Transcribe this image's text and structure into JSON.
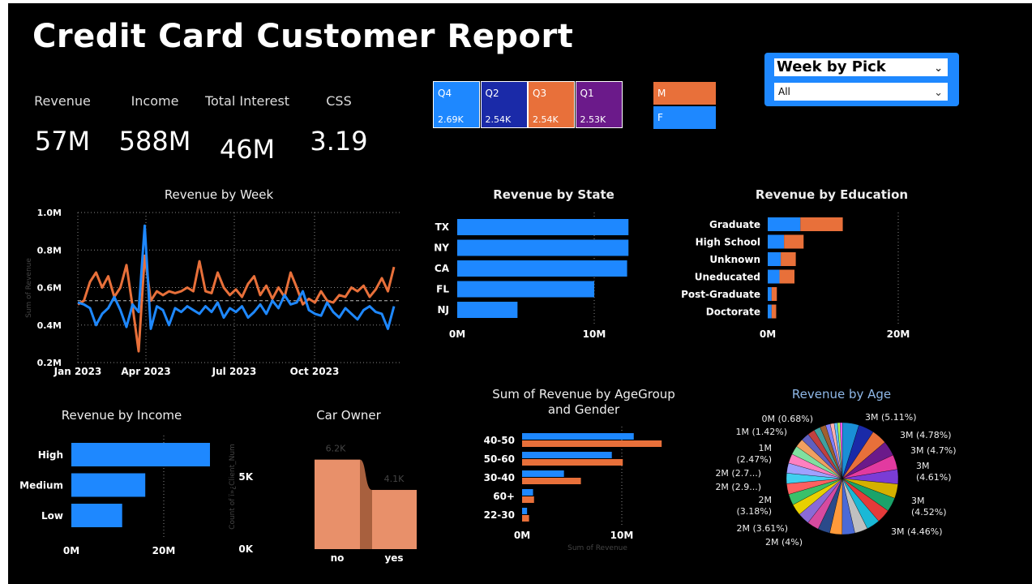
{
  "report": {
    "title": "Credit Card Customer Report"
  },
  "kpis": [
    {
      "label": "Revenue",
      "value": "57M"
    },
    {
      "label": "Income",
      "value": "588M"
    },
    {
      "label": "Total Interest",
      "value": "46M"
    },
    {
      "label": "CSS",
      "value": "3.19"
    }
  ],
  "quarters": [
    {
      "name": "Q4",
      "value": "2.69K",
      "color": "#1e88ff"
    },
    {
      "name": "Q2",
      "value": "2.54K",
      "color": "#1a2aa8"
    },
    {
      "name": "Q3",
      "value": "2.54K",
      "color": "#e8703a"
    },
    {
      "name": "Q1",
      "value": "2.53K",
      "color": "#6b1a8a"
    }
  ],
  "gender_tiles": [
    {
      "name": "M",
      "color": "#e8703a"
    },
    {
      "name": "F",
      "color": "#1e88ff"
    }
  ],
  "slicer": {
    "title": "Week by Pick",
    "selected": "All"
  },
  "colors": {
    "blue": "#1e88ff",
    "orange": "#e8703a",
    "salmon": "#e8906a"
  },
  "chart_data": [
    {
      "id": "week",
      "type": "line",
      "title": "Revenue by Week",
      "ylabel": "Sum of Revenue",
      "xlabel": "",
      "x_ticks": [
        "Jan 2023",
        "Apr 2023",
        "Jul 2023",
        "Oct 2023"
      ],
      "y_ticks": [
        "0.2M",
        "0.4M",
        "0.6M",
        "0.8M",
        "1.0M"
      ],
      "ylim": [
        0.2,
        1.0
      ],
      "series": [
        {
          "color": "#1e88ff",
          "values": [
            0.52,
            0.51,
            0.49,
            0.4,
            0.46,
            0.49,
            0.55,
            0.48,
            0.39,
            0.51,
            0.47,
            0.93,
            0.38,
            0.5,
            0.48,
            0.4,
            0.49,
            0.47,
            0.5,
            0.48,
            0.46,
            0.5,
            0.47,
            0.52,
            0.44,
            0.49,
            0.47,
            0.5,
            0.44,
            0.47,
            0.51,
            0.46,
            0.53,
            0.49,
            0.56,
            0.51,
            0.52,
            0.58,
            0.48,
            0.46,
            0.45,
            0.52,
            0.47,
            0.44,
            0.49,
            0.46,
            0.43,
            0.48,
            0.5,
            0.47,
            0.46,
            0.38,
            0.5
          ]
        },
        {
          "color": "#e8703a",
          "values": [
            0.51,
            0.53,
            0.63,
            0.68,
            0.6,
            0.66,
            0.55,
            0.6,
            0.72,
            0.5,
            0.26,
            0.77,
            0.53,
            0.58,
            0.56,
            0.58,
            0.57,
            0.58,
            0.6,
            0.58,
            0.74,
            0.58,
            0.57,
            0.68,
            0.6,
            0.56,
            0.59,
            0.55,
            0.62,
            0.66,
            0.56,
            0.61,
            0.54,
            0.6,
            0.55,
            0.68,
            0.6,
            0.51,
            0.54,
            0.52,
            0.58,
            0.53,
            0.52,
            0.56,
            0.55,
            0.6,
            0.58,
            0.61,
            0.55,
            0.59,
            0.65,
            0.58,
            0.71
          ]
        }
      ]
    },
    {
      "id": "state",
      "type": "bar",
      "title": "Revenue by State",
      "categories": [
        "TX",
        "NY",
        "CA",
        "FL",
        "NJ"
      ],
      "values": [
        12.5,
        12.5,
        12.4,
        10.0,
        4.4
      ],
      "x_ticks": [
        "0M",
        "10M"
      ],
      "xlim": [
        0,
        10
      ]
    },
    {
      "id": "education",
      "type": "bar",
      "title": "Revenue by Education",
      "categories": [
        "Graduate",
        "High School",
        "Unknown",
        "Uneducated",
        "Post-Graduate",
        "Doctorate"
      ],
      "series": [
        {
          "name": "F",
          "values": [
            5.0,
            2.5,
            2.0,
            1.8,
            0.6,
            0.6
          ]
        },
        {
          "name": "M",
          "values": [
            6.5,
            3.0,
            2.3,
            2.3,
            0.8,
            0.7
          ]
        }
      ],
      "x_ticks": [
        "0M",
        "20M"
      ],
      "xlim": [
        0,
        20
      ]
    },
    {
      "id": "income",
      "type": "bar",
      "title": "Revenue by Income",
      "categories": [
        "High",
        "Medium",
        "Low"
      ],
      "values": [
        30,
        16,
        11
      ],
      "x_ticks": [
        "0M",
        "20M"
      ],
      "xlim": [
        0,
        20
      ]
    },
    {
      "id": "car",
      "type": "area",
      "title": "Car Owner",
      "ylabel": "Count of ï»¿Client_Num",
      "categories": [
        "no",
        "yes"
      ],
      "values": [
        6.2,
        4.1
      ],
      "value_labels": [
        "6.2K",
        "4.1K"
      ],
      "y_ticks": [
        "0K",
        "5K"
      ]
    },
    {
      "id": "agegroup",
      "type": "bar",
      "title": "Sum of Revenue by AgeGroup and Gender",
      "xlabel": "Sum of Revenue",
      "categories": [
        "40-50",
        "50-60",
        "30-40",
        "60+",
        "22-30"
      ],
      "series": [
        {
          "name": "F",
          "values": [
            11.2,
            9.0,
            4.2,
            1.1,
            0.5
          ]
        },
        {
          "name": "M",
          "values": [
            14.0,
            10.1,
            5.9,
            1.2,
            0.7
          ]
        }
      ],
      "x_ticks": [
        "0M",
        "10M"
      ],
      "xlim": [
        0,
        10
      ]
    },
    {
      "id": "age",
      "type": "pie",
      "title": "Revenue by Age",
      "labels": [
        "3M (5.11%)",
        "3M (4.78%)",
        "3M (4.7%)",
        "3M\n(4.61%)",
        "3M\n(4.52%)",
        "3M (4.46%)",
        "2M (4%)",
        "2M (3.61%)",
        "2M\n(3.18%)",
        "2M (2.9...)",
        "2M (2.7...)",
        "1M\n(2.47%)",
        "1M (1.42%)",
        "0M (0.68%)"
      ],
      "values": [
        5.11,
        4.78,
        4.7,
        4.61,
        4.52,
        4.46,
        4.4,
        4.3,
        4.2,
        4.1,
        4.0,
        3.9,
        3.8,
        3.7,
        3.6,
        3.61,
        3.5,
        3.4,
        3.3,
        3.18,
        3.1,
        2.9,
        2.7,
        2.6,
        2.47,
        2.2,
        2.0,
        1.8,
        1.42,
        1.2,
        1.0,
        0.8,
        0.68
      ]
    }
  ]
}
